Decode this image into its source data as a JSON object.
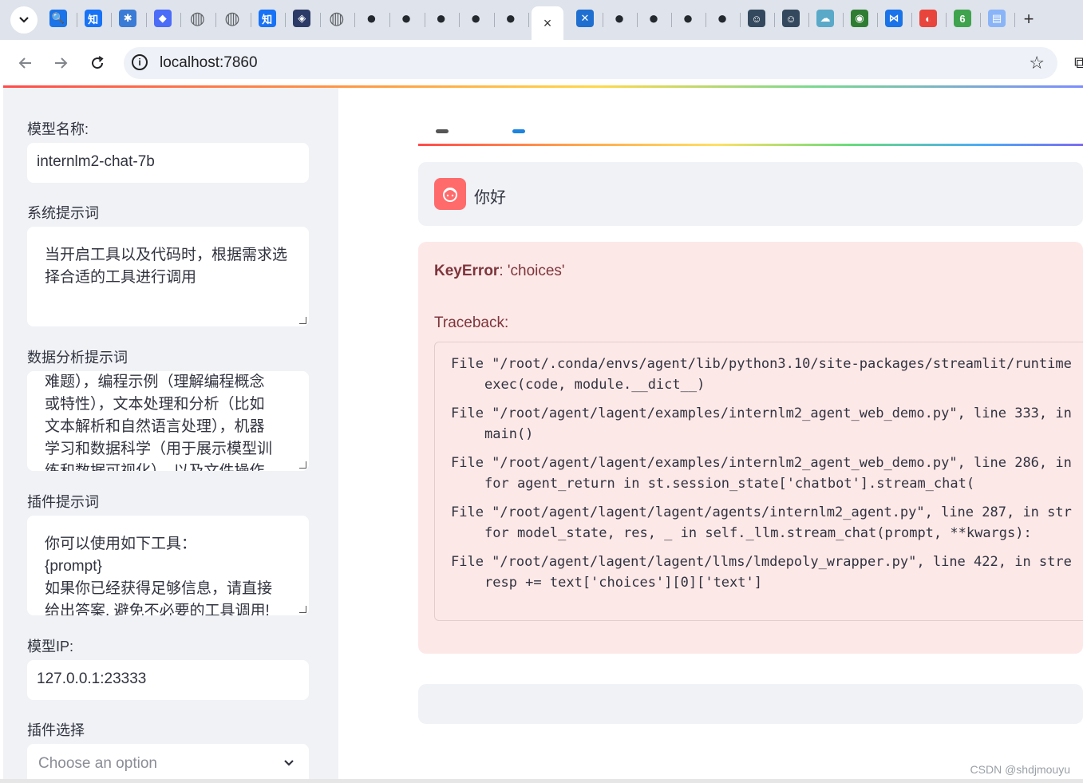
{
  "browser": {
    "url": "localhost:7860",
    "active_tab_close": "×",
    "new_tab": "+",
    "tabs": [
      {
        "icon": "search-icon",
        "color": "#1a73e8",
        "glyph": "🔍"
      },
      {
        "icon": "zhihu-icon",
        "color": "#1772f6",
        "glyph": "知"
      },
      {
        "icon": "puzzle-icon",
        "color": "#3a7bd5",
        "glyph": "✱"
      },
      {
        "icon": "diamond-icon",
        "color": "#4a6cf7",
        "glyph": "◆"
      },
      {
        "icon": "globe-icon",
        "color": "#5f6368",
        "glyph": "◍"
      },
      {
        "icon": "globe-icon",
        "color": "#5f6368",
        "glyph": "◍"
      },
      {
        "icon": "zhihu-icon",
        "color": "#1772f6",
        "glyph": "知"
      },
      {
        "icon": "app-icon",
        "color": "#2b3a67",
        "glyph": "◈"
      },
      {
        "icon": "globe-icon",
        "color": "#5f6368",
        "glyph": "◍"
      },
      {
        "icon": "github-icon",
        "color": "#24292f",
        "glyph": "●"
      },
      {
        "icon": "github-icon",
        "color": "#24292f",
        "glyph": "●"
      },
      {
        "icon": "github-icon",
        "color": "#24292f",
        "glyph": "●"
      },
      {
        "icon": "github-icon",
        "color": "#24292f",
        "glyph": "●"
      },
      {
        "icon": "github-icon",
        "color": "#24292f",
        "glyph": "●"
      }
    ],
    "tabs_right": [
      {
        "icon": "close-x-icon",
        "color": "#1f6fd1",
        "glyph": "✕"
      },
      {
        "icon": "github-icon",
        "color": "#24292f",
        "glyph": "●"
      },
      {
        "icon": "github-icon",
        "color": "#24292f",
        "glyph": "●"
      },
      {
        "icon": "github-icon",
        "color": "#24292f",
        "glyph": "●"
      },
      {
        "icon": "github-icon",
        "color": "#24292f",
        "glyph": "●"
      },
      {
        "icon": "robot-icon",
        "color": "#34495e",
        "glyph": "☺"
      },
      {
        "icon": "robot-icon",
        "color": "#34495e",
        "glyph": "☺"
      },
      {
        "icon": "cloud-icon",
        "color": "#5aa9c9",
        "glyph": "☁"
      },
      {
        "icon": "frog-icon",
        "color": "#2e7d32",
        "glyph": "◉"
      },
      {
        "icon": "bowtie-icon",
        "color": "#1a73e8",
        "glyph": "⋈"
      },
      {
        "icon": "flame-icon",
        "color": "#e8453c",
        "glyph": "◐"
      },
      {
        "icon": "leaf-icon",
        "color": "#3fa34d",
        "glyph": "6"
      },
      {
        "icon": "doc-icon",
        "color": "#8ab4f8",
        "glyph": "▤"
      }
    ]
  },
  "sidebar": {
    "model_name_label": "模型名称:",
    "model_name_value": "internlm2-chat-7b",
    "system_prompt_label": "系统提示词",
    "system_prompt_value": "当开启工具以及代码时，根据需求选择合适的工具进行调用",
    "data_prompt_label": "数据分析提示词",
    "data_prompt_lines": [
      "难题），编程示例（理解编程概念",
      "或特性），文本处理和分析（比如",
      "文本解析和自然语言处理），机器",
      "学习和数据科学（用于展示模型训",
      "练和数据可视化），以及文件操作"
    ],
    "plugin_prompt_label": "插件提示词",
    "plugin_prompt_lines": [
      "你可以使用如下工具：",
      "{prompt}",
      "如果你已经获得足够信息，请直接",
      "给出答案. 避免不必要的工具调用!"
    ],
    "model_ip_label": "模型IP:",
    "model_ip_value": "127.0.0.1:23333",
    "plugin_select_label": "插件选择",
    "plugin_select_placeholder": "Choose an option"
  },
  "main": {
    "user_message": "你好",
    "error_type": "KeyError",
    "error_msg": ": 'choices'",
    "traceback_label": "Traceback:",
    "traceback": [
      {
        "file": "File \"/root/.conda/envs/agent/lib/python3.10/site-packages/streamlit/runtime",
        "code": "exec(code, module.__dict__)"
      },
      {
        "file": "File \"/root/agent/lagent/examples/internlm2_agent_web_demo.py\", line 333, in",
        "code": "main()"
      },
      {
        "file": "File \"/root/agent/lagent/examples/internlm2_agent_web_demo.py\", line 286, in",
        "code": "for agent_return in st.session_state['chatbot'].stream_chat("
      },
      {
        "file": "File \"/root/agent/lagent/lagent/agents/internlm2_agent.py\", line 287, in str",
        "code": "for model_state, res, _ in self._llm.stream_chat(prompt, **kwargs):"
      },
      {
        "file": "File \"/root/agent/lagent/lagent/llms/lmdepoly_wrapper.py\", line 422, in stre",
        "code": "resp += text['choices'][0]['text']"
      }
    ]
  },
  "watermark": "CSDN @shdjmouyu"
}
